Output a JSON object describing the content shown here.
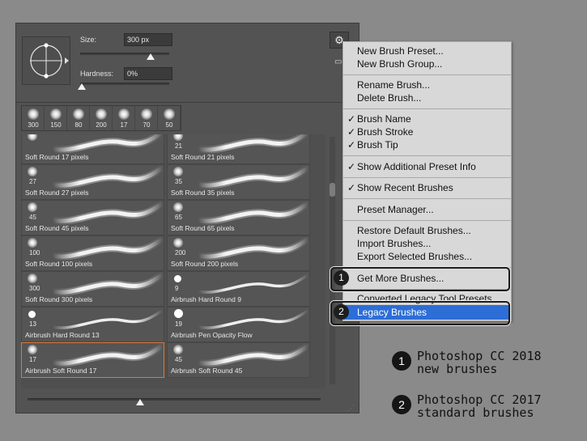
{
  "brush_panel": {
    "size_label": "Size:",
    "size_value": "300 px",
    "hardness_label": "Hardness:",
    "hardness_value": "0%",
    "recent_brushes": [
      "300",
      "150",
      "80",
      "200",
      "17",
      "70",
      "50"
    ],
    "brushes": [
      {
        "num": "",
        "name": "Soft Round 17 pixels",
        "tip": "soft"
      },
      {
        "num": "21",
        "name": "Soft Round 21 pixels",
        "tip": "soft"
      },
      {
        "num": "27",
        "name": "Soft Round 27 pixels",
        "tip": "soft"
      },
      {
        "num": "35",
        "name": "Soft Round 35 pixels",
        "tip": "soft"
      },
      {
        "num": "45",
        "name": "Soft Round 45 pixels",
        "tip": "soft"
      },
      {
        "num": "65",
        "name": "Soft Round 65 pixels",
        "tip": "soft"
      },
      {
        "num": "100",
        "name": "Soft Round 100 pixels",
        "tip": "soft"
      },
      {
        "num": "200",
        "name": "Soft Round 200 pixels",
        "tip": "soft"
      },
      {
        "num": "300",
        "name": "Soft Round 300 pixels",
        "tip": "soft"
      },
      {
        "num": "9",
        "name": "Airbrush Hard Round 9",
        "tip": "hard"
      },
      {
        "num": "13",
        "name": "Airbrush Hard Round 13",
        "tip": "hard"
      },
      {
        "num": "19",
        "name": "Airbrush Pen Opacity Flow",
        "tip": "hard-big"
      },
      {
        "num": "17",
        "name": "Airbrush Soft Round 17",
        "tip": "soft",
        "selected": true
      },
      {
        "num": "45",
        "name": "Airbrush Soft Round 45",
        "tip": "soft"
      }
    ]
  },
  "menu": {
    "new_brush_preset": "New Brush Preset...",
    "new_brush_group": "New Brush Group...",
    "rename_brush": "Rename Brush...",
    "delete_brush": "Delete Brush...",
    "check_mark": "✓",
    "brush_name": "Brush Name",
    "brush_stroke": "Brush Stroke",
    "brush_tip": "Brush Tip",
    "show_additional": "Show Additional Preset Info",
    "show_recent": "Show Recent Brushes",
    "preset_manager": "Preset Manager...",
    "restore_default": "Restore Default Brushes...",
    "import_brushes": "Import Brushes...",
    "export_selected": "Export Selected Brushes...",
    "get_more": "Get More Brushes...",
    "converted_legacy": "Converted Legacy Tool Presets",
    "legacy_brushes": "Legacy Brushes",
    "highlight_color": "#2d6ed6"
  },
  "callouts": {
    "one": "1",
    "two": "2"
  },
  "legend": {
    "item1_num": "1",
    "item1_line1": "Photoshop CC 2018",
    "item1_line2": "new brushes",
    "item2_num": "2",
    "item2_line1": "Photoshop CC 2017",
    "item2_line2": "standard brushes"
  }
}
